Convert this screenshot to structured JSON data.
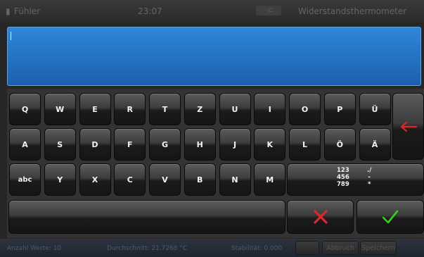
{
  "header": {
    "left_label": "Fühler",
    "time": "23:07",
    "usb_icon": "usb-icon",
    "right_label": "Widerstandsthermometer"
  },
  "input": {
    "value": ""
  },
  "keyboard": {
    "row1": [
      "Q",
      "W",
      "E",
      "R",
      "T",
      "Z",
      "U",
      "I",
      "O",
      "P",
      "Ü"
    ],
    "row2": [
      "A",
      "S",
      "D",
      "F",
      "G",
      "H",
      "J",
      "K",
      "L",
      "Ö",
      "Ä"
    ],
    "row3": [
      "abc",
      "Y",
      "X",
      "C",
      "V",
      "B",
      "N",
      "M"
    ],
    "numsym_col1": "123\n456\n789",
    "numsym_col2": "./\n-\n*",
    "backspace_icon": "backspace-arrow-icon",
    "cancel_icon": "cross-icon",
    "confirm_icon": "checkmark-icon",
    "colors": {
      "backspace_arrow": "#d8262a",
      "cross": "#e0282c",
      "check": "#33d11c"
    }
  },
  "statusbar": {
    "count": "Anzahl Werte: 10",
    "average": "Durchschnitt: 21.7268 °C",
    "stability": "Stabilität: 0.000",
    "cancel_label": "Abbruch",
    "save_label": "Speichern"
  }
}
